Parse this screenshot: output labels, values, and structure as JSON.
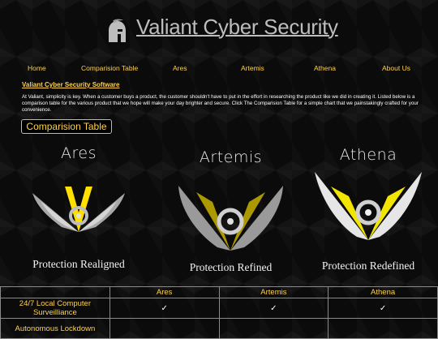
{
  "header": {
    "title": "Valiant Cyber Security",
    "icon": "spartan-helmet-icon"
  },
  "nav": {
    "items": [
      {
        "label": "Home"
      },
      {
        "label": "Comparision Table"
      },
      {
        "label": "Ares"
      },
      {
        "label": "Artemis"
      },
      {
        "label": "Athena"
      },
      {
        "label": "About Us"
      }
    ]
  },
  "intro": {
    "title": "Valiant Cyber Security Software",
    "text": "At Valiant, simplicity is key. When a customer buys a product, the customer shouldn't have to put in the effort in researching the product like we did in creating it. Listed below is a comparison table for the various product that we hope will make your day brighter and secure. Click The Comparision Table for a simple chart that we painstakingly crafted for your convenience.",
    "button_label": "Comparision Table"
  },
  "products": [
    {
      "name": "Ares",
      "tagline": "Protection Realigned"
    },
    {
      "name": "Artemis",
      "tagline": "Protection Refined"
    },
    {
      "name": "Athena",
      "tagline": "Protection Redefined"
    }
  ],
  "table": {
    "headers": [
      "",
      "Ares",
      "Artemis",
      "Athena"
    ],
    "rows": [
      {
        "feature": "24/7 Local Computer Surveilliance",
        "ares": "✓",
        "artemis": "✓",
        "athena": "✓"
      },
      {
        "feature": "Autonomous Lockdown",
        "ares": "",
        "artemis": "",
        "athena": ""
      }
    ]
  },
  "colors": {
    "accent": "#ffd24a",
    "background": "#0b0b0b",
    "title": "#bdbdbd"
  }
}
